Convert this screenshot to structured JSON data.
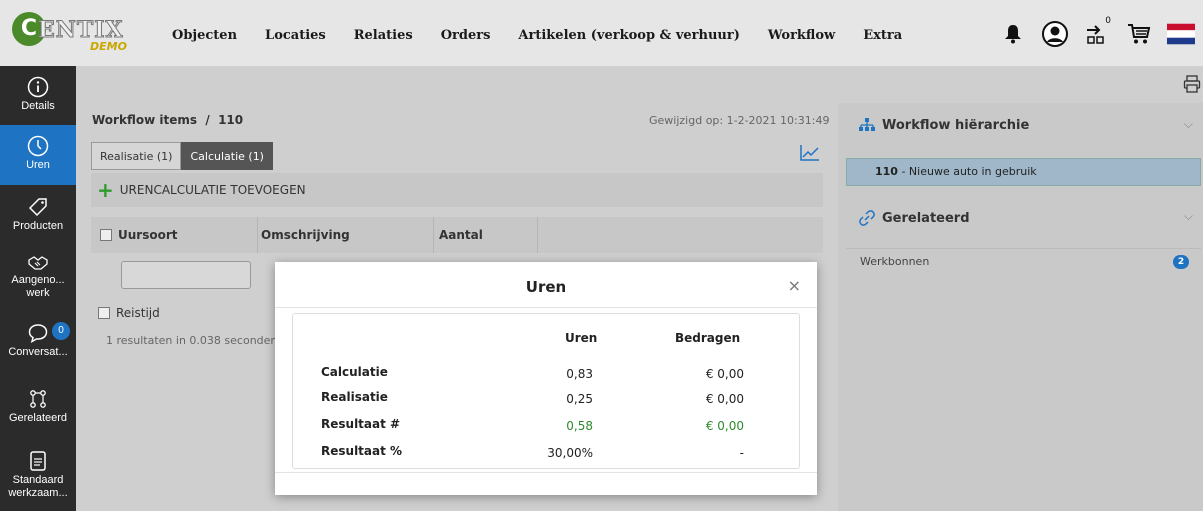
{
  "brand": {
    "logo_letter": "C",
    "name": "ENTIX",
    "tag": "DEMO"
  },
  "nav": [
    "Objecten",
    "Locaties",
    "Relaties",
    "Orders",
    "Artikelen (verkoop & verhuur)",
    "Workflow",
    "Extra"
  ],
  "top_icons": {
    "cart_count": "0"
  },
  "sidebar": {
    "items": [
      {
        "label": "Details",
        "icon": "info-icon"
      },
      {
        "label": "Uren",
        "icon": "clock-icon"
      },
      {
        "label": "Producten",
        "icon": "tag-icon"
      },
      {
        "label": "Aangeno... werk",
        "icon": "handshake-icon"
      },
      {
        "label": "Conversat...",
        "icon": "chat-icon",
        "badge": "0"
      },
      {
        "label": "Gerelateerd",
        "icon": "related-icon"
      },
      {
        "label": "Standaard werkzaam...",
        "icon": "document-icon"
      }
    ]
  },
  "main": {
    "breadcrumb": "Workflow items  /  110",
    "modified": "Gewijzigd op: 1-2-2021 10:31:49",
    "tabs": [
      "Realisatie (1)",
      "Calculatie (1)"
    ],
    "add_label": "URENCALCULATIE TOEVOEGEN",
    "columns": [
      "Uursoort",
      "Omschrijving",
      "Aantal"
    ],
    "row_label": "Reistijd",
    "results": "1 resultaten in 0.038 seconden"
  },
  "right": {
    "hierarchy_title": "Workflow hiërarchie",
    "hierarchy_item_id": "110",
    "hierarchy_item_text": " - Nieuwe auto in gebruik",
    "related_title": "Gerelateerd",
    "related_item": "Werkbonnen",
    "related_count": "2"
  },
  "modal": {
    "title": "Uren",
    "close": "×",
    "col_hours": "Uren",
    "col_amounts": "Bedragen",
    "rows": [
      {
        "label": "Calculatie",
        "hours": "0,83",
        "amount": "€ 0,00"
      },
      {
        "label": "Realisatie",
        "hours": "0,25",
        "amount": "€ 0,00"
      },
      {
        "label": "Resultaat #",
        "hours": "0,58",
        "amount": "€ 0,00"
      },
      {
        "label": "Resultaat %",
        "hours": "30,00%",
        "amount": "-"
      }
    ]
  }
}
